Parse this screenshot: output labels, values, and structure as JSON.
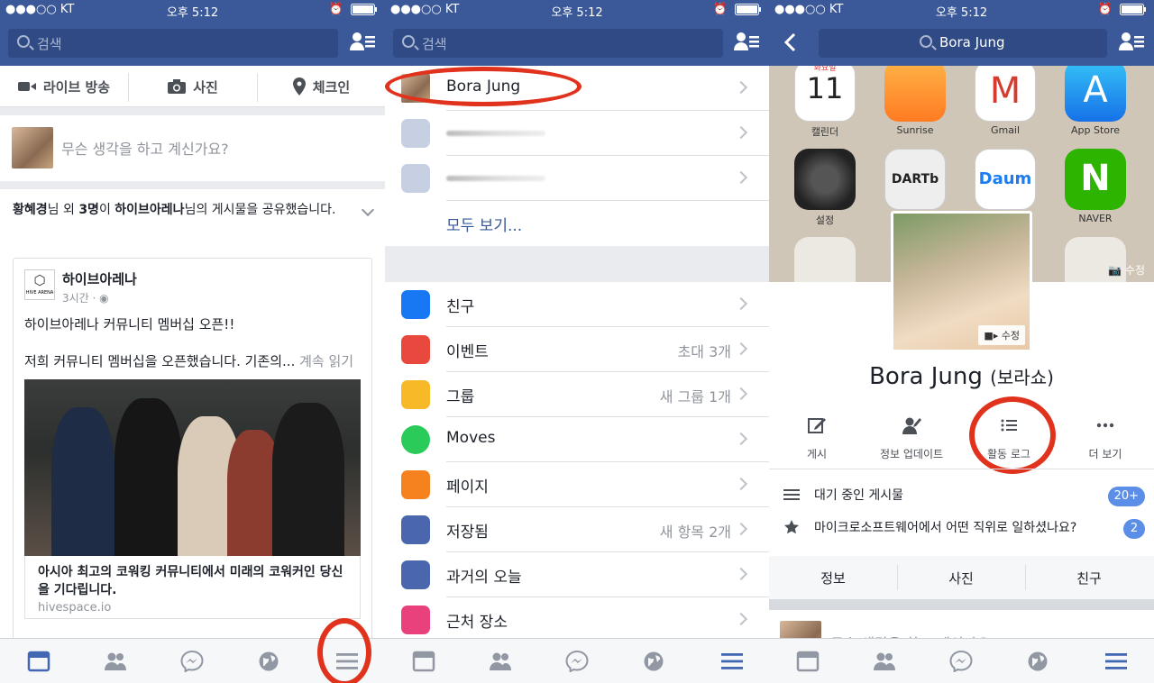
{
  "status": {
    "carrier": "●●●○○ KT",
    "time": "오후 5:12"
  },
  "panel1": {
    "search_placeholder": "검색",
    "composer": {
      "live": "라이브 방송",
      "photo": "사진",
      "checkin": "체크인"
    },
    "whats_on_mind": "무슨 생각을 하고 계신가요?",
    "share_line_a": "황혜경",
    "share_line_b": "님 외 ",
    "share_line_c": "3명",
    "share_line_d": "이 ",
    "share_line_e": "하이브아레나",
    "share_line_f": "님의 게시물을 공유했습니다.",
    "post": {
      "logo_text": "HIVE ARENA",
      "author": "하이브아레나",
      "meta": "3시간 · ",
      "line1": "하이브아레나 커뮤니티 멤버십 오픈!!",
      "line2": "저희 커뮤니티 멤버십을 오픈했습니다. 기존의... ",
      "more": "계속 읽기",
      "link_title": "아시아 최고의 코워킹 커뮤니티에서 미래의 코워커인 당신을 기다립니다.",
      "link_domain": "hivespace.io"
    }
  },
  "panel2": {
    "search_placeholder": "검색",
    "top_items": [
      {
        "label": "Bora Jung"
      },
      {
        "label": ""
      },
      {
        "label": ""
      }
    ],
    "see_all": "모두 보기...",
    "items": [
      {
        "label": "친구",
        "right": "",
        "color": "#1877f2",
        "icon": "friends-icon"
      },
      {
        "label": "이벤트",
        "right": "초대 3개",
        "color": "#e9483f",
        "icon": "calendar-icon"
      },
      {
        "label": "그룹",
        "right": "새 그룹 1개",
        "color": "#f7b928",
        "icon": "groups-icon"
      },
      {
        "label": "Moves",
        "right": "",
        "color": "#2bcb5a",
        "icon": "moves-icon"
      },
      {
        "label": "페이지",
        "right": "",
        "color": "#f5821f",
        "icon": "flag-icon"
      },
      {
        "label": "저장됨",
        "right": "새 항목 2개",
        "color": "#4a67ad",
        "icon": "bookmark-icon"
      },
      {
        "label": "과거의 오늘",
        "right": "",
        "color": "#4a67ad",
        "icon": "history-icon"
      },
      {
        "label": "근처 장소",
        "right": "",
        "color": "#e9417b",
        "icon": "location-icon"
      }
    ]
  },
  "panel3": {
    "search_text": "Bora Jung",
    "apps": [
      {
        "label": "캘린더",
        "top": "화요일",
        "big": "11"
      },
      {
        "label": "Sunrise"
      },
      {
        "label": "Gmail"
      },
      {
        "label": "App Store"
      },
      {
        "label": "설정"
      },
      {
        "label": "DARTb"
      },
      {
        "label": "Daum"
      },
      {
        "label": "NAVER"
      }
    ],
    "cover_edit": "수정",
    "pic_edit": "수정",
    "name": "Bora Jung",
    "alt_name": "(보라쇼)",
    "actions": {
      "post": "게시",
      "update": "정보 업데이트",
      "activity": "활동 로그",
      "more": "더 보기"
    },
    "pending_label": "대기 중인 게시물",
    "pending_count": "20+",
    "question_label": "마이크로소프트웨어에서 어떤 직위로 일하셨나요?",
    "question_count": "2",
    "tabs": {
      "about": "정보",
      "photos": "사진",
      "friends": "친구"
    },
    "peek_text": "무슨 생각을 하고 계신가요?"
  },
  "colors": {
    "header": "#3b5998",
    "highlight_circle": "#e0321c",
    "active_tab": "#4267b2"
  }
}
